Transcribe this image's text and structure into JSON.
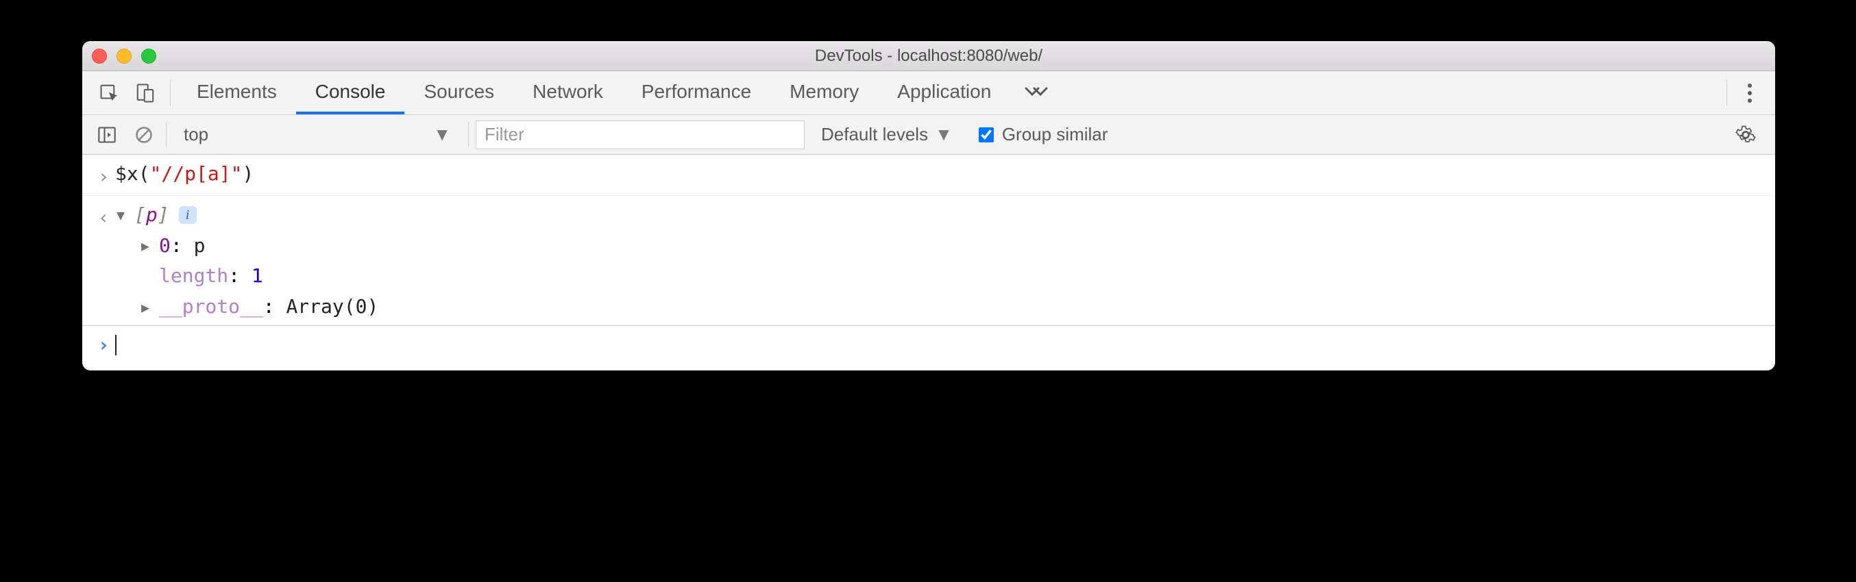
{
  "window": {
    "title": "DevTools - localhost:8080/web/"
  },
  "tabs": {
    "items": [
      "Elements",
      "Console",
      "Sources",
      "Network",
      "Performance",
      "Memory",
      "Application"
    ],
    "active_index": 1
  },
  "console_toolbar": {
    "context": "top",
    "filter_placeholder": "Filter",
    "levels_label": "Default levels",
    "group_similar_label": "Group similar",
    "group_similar_checked": true
  },
  "console": {
    "input_line": {
      "fn": "$x",
      "open": "(",
      "str": "\"//p[a]\"",
      "close": ")"
    },
    "output": {
      "array_label_open": "[",
      "array_item": "p",
      "array_label_close": "]",
      "info_badge": "i",
      "children": [
        {
          "disclosure": "right",
          "key": "0",
          "sep": ": ",
          "val": "p",
          "key_class": "prop-idx",
          "val_class": "prop-val"
        },
        {
          "disclosure": "",
          "key": "length",
          "sep": ": ",
          "val": "1",
          "key_class": "prop-name-dim",
          "val_class": "prop-length-val"
        },
        {
          "disclosure": "right",
          "key": "__proto__",
          "sep": ": ",
          "val": "Array(0)",
          "key_class": "prop-proto",
          "val_class": "prop-proto-val"
        }
      ]
    }
  }
}
